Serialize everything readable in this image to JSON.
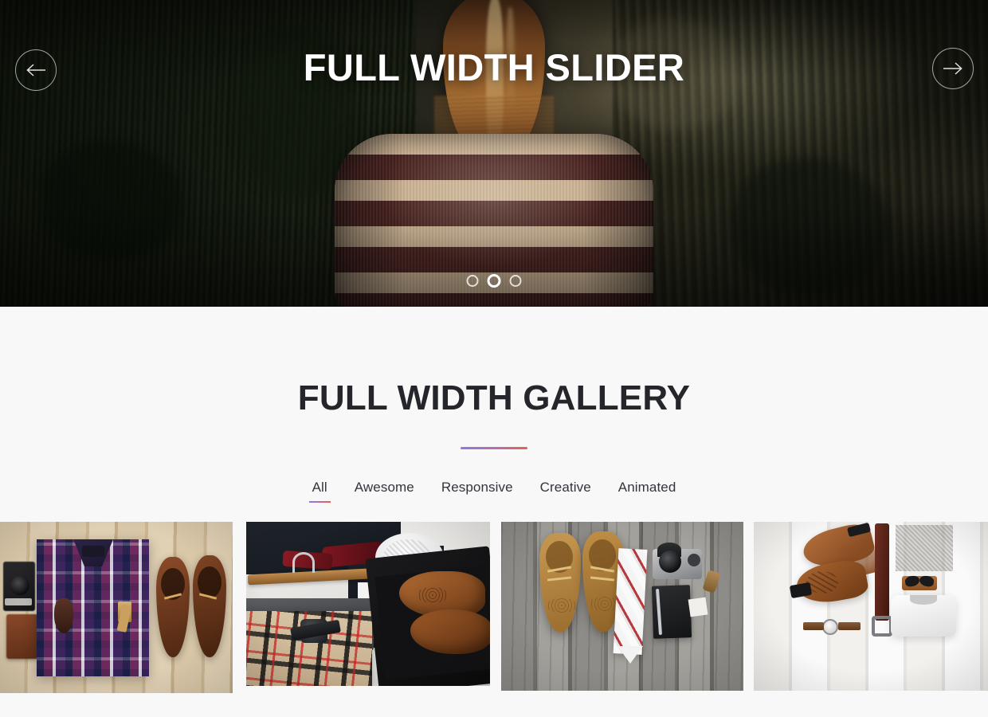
{
  "slider": {
    "title": "FULL WIDTH SLIDER",
    "prev_label": "Previous slide",
    "next_label": "Next slide",
    "prev_icon": "arrow-left-icon",
    "next_icon": "arrow-right-icon",
    "dots": [
      {
        "label": "Go to slide 1",
        "active": false
      },
      {
        "label": "Go to slide 2",
        "active": true
      },
      {
        "label": "Go to slide 3",
        "active": false
      }
    ],
    "slide_alt": "Woman with long blonde-brown hair in a brown and beige striped sweater seen from behind, facing a forested mountain valley"
  },
  "gallery": {
    "title": "FULL WIDTH GALLERY",
    "divider_gradient_from": "#8b7ae0",
    "divider_gradient_to": "#e8604f",
    "filters": [
      {
        "label": "All",
        "active": true
      },
      {
        "label": "Awesome",
        "active": false
      },
      {
        "label": "Responsive",
        "active": false
      },
      {
        "label": "Creative",
        "active": false
      },
      {
        "label": "Animated",
        "active": false
      }
    ],
    "items": [
      {
        "alt": "Flatlay of a purple and blue plaid flannel shirt with a vintage camera, leather wallet and brown boat shoes on light wood planks"
      },
      {
        "alt": "Flatlay of formal menswear: navy suit, red tie on a wooden hanger, grey trousers, tartan scarf, wristwatch and brown brogues in a shoe box"
      },
      {
        "alt": "Flatlay of tan leather brogues, a white and red striped tie, vintage film camera and black notebook with pen on weathered grey wood"
      },
      {
        "alt": "Flatlay of brown leather boots, leather belt, folded grey trousers, sunglasses, white t-shirt and a wristwatch on white wood"
      }
    ]
  },
  "colors": {
    "page_background": "#f8f8f8",
    "heading": "#25262b",
    "filter_text": "#33353c",
    "slide_title": "#ffffff"
  }
}
